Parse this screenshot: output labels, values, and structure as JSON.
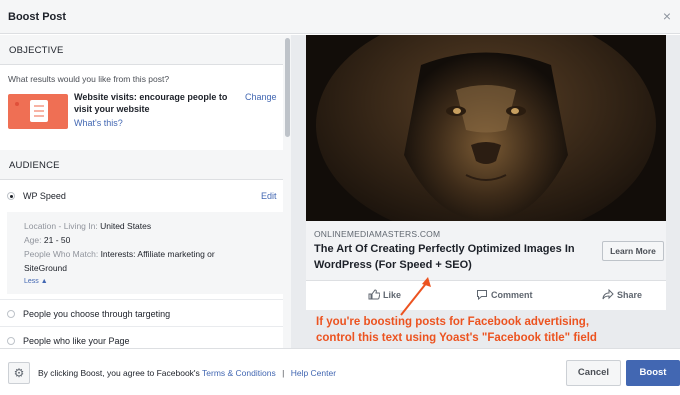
{
  "dialog": {
    "title": "Boost Post",
    "close_glyph": "×"
  },
  "objective": {
    "header": "OBJECTIVE",
    "question": "What results would you like from this post?",
    "title": "Website visits: encourage people to visit your website",
    "whats_this": "What's this?",
    "change": "Change"
  },
  "audience": {
    "header": "AUDIENCE",
    "selected": "WP Speed",
    "edit": "Edit",
    "details": {
      "location_label": "Location - Living In:",
      "location_value": "United States",
      "age_label": "Age:",
      "age_value": "21 - 50",
      "match_label": "People Who Match:",
      "match_value": "Interests: Affiliate marketing or SiteGround",
      "less": "Less"
    },
    "options": [
      "People you choose through targeting",
      "People who like your Page"
    ]
  },
  "preview": {
    "domain": "ONLINEMEDIAMASTERS.COM",
    "headline": "The Art Of Creating Perfectly Optimized Images In WordPress (For Speed + SEO)",
    "learn_more": "Learn More",
    "actions": {
      "like": "Like",
      "comment": "Comment",
      "share": "Share"
    }
  },
  "annotation": {
    "line1": "If you're boosting posts for Facebook advertising,",
    "line2": "control this text using Yoast's \"Facebook title\" field",
    "color": "#ec5320"
  },
  "footer": {
    "agree_text": "By clicking Boost, you agree to Facebook's",
    "terms": "Terms & Conditions",
    "separator": "|",
    "help": "Help Center",
    "cancel": "Cancel",
    "boost": "Boost"
  },
  "colors": {
    "accent": "#4267b2",
    "thumb": "#ef6f54"
  }
}
